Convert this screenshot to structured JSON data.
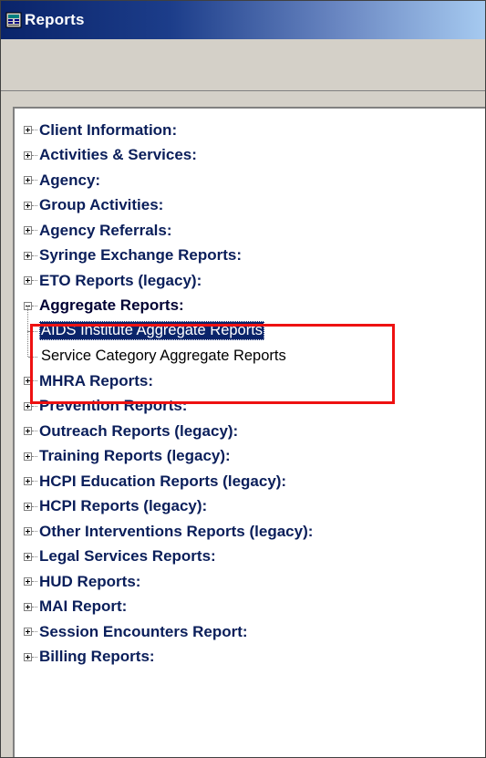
{
  "window": {
    "title": "Reports",
    "title_icon": "reports-app-icon"
  },
  "colors": {
    "title_gradient_start": "#0a246a",
    "title_gradient_end": "#a6caf0",
    "node_text": "#0a1e5a",
    "selection_bg": "#0a246a",
    "annotation_box": "#ee1111"
  },
  "tree": {
    "nodes": [
      {
        "label": "Client Information:",
        "state": "collapsed"
      },
      {
        "label": "Activities & Services:",
        "state": "collapsed"
      },
      {
        "label": "Agency:",
        "state": "collapsed"
      },
      {
        "label": "Group Activities:",
        "state": "collapsed"
      },
      {
        "label": "Agency Referrals:",
        "state": "collapsed"
      },
      {
        "label": "Syringe Exchange Reports:",
        "state": "collapsed"
      },
      {
        "label": "ETO Reports (legacy):",
        "state": "collapsed"
      },
      {
        "label": "Aggregate Reports:",
        "state": "expanded",
        "children": [
          {
            "label": "AIDS Institute Aggregate Reports",
            "selected": true
          },
          {
            "label": "Service Category Aggregate Reports",
            "selected": false
          }
        ]
      },
      {
        "label": "MHRA Reports:",
        "state": "collapsed"
      },
      {
        "label": "Prevention Reports:",
        "state": "collapsed"
      },
      {
        "label": "Outreach Reports (legacy):",
        "state": "collapsed"
      },
      {
        "label": "Training Reports (legacy):",
        "state": "collapsed"
      },
      {
        "label": "HCPI Education Reports (legacy):",
        "state": "collapsed"
      },
      {
        "label": "HCPI Reports (legacy):",
        "state": "collapsed"
      },
      {
        "label": "Other Interventions Reports (legacy):",
        "state": "collapsed"
      },
      {
        "label": "Legal Services Reports:",
        "state": "collapsed"
      },
      {
        "label": "HUD Reports:",
        "state": "collapsed"
      },
      {
        "label": "MAI Report:",
        "state": "collapsed"
      },
      {
        "label": "Session Encounters Report:",
        "state": "collapsed"
      },
      {
        "label": "Billing Reports:",
        "state": "collapsed"
      }
    ]
  }
}
